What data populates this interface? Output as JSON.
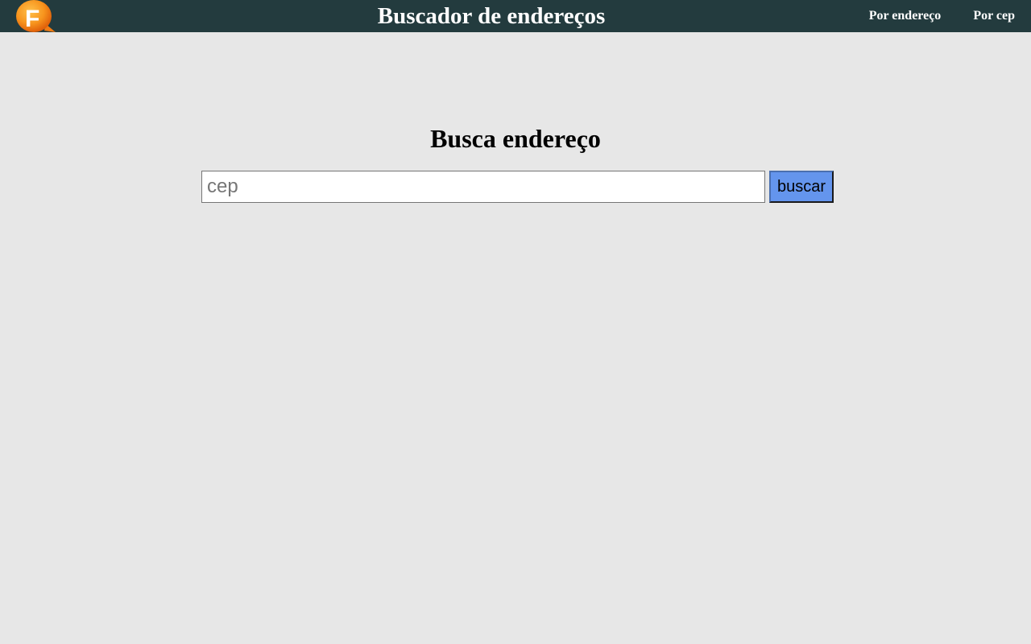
{
  "header": {
    "logo_icon": "f-logo-speech-bubble-icon",
    "logo_letter": "F",
    "title": "Buscador de endereços",
    "nav": [
      {
        "label": "Por endereço"
      },
      {
        "label": "Por cep"
      }
    ],
    "colors": {
      "background": "#233b3e",
      "logo_orange": "#f7941d"
    }
  },
  "main": {
    "heading": "Busca endereço",
    "search": {
      "value": "",
      "placeholder": "cep",
      "button_label": "buscar"
    },
    "colors": {
      "background": "#e7e7e7",
      "button": "#6495ed"
    }
  }
}
